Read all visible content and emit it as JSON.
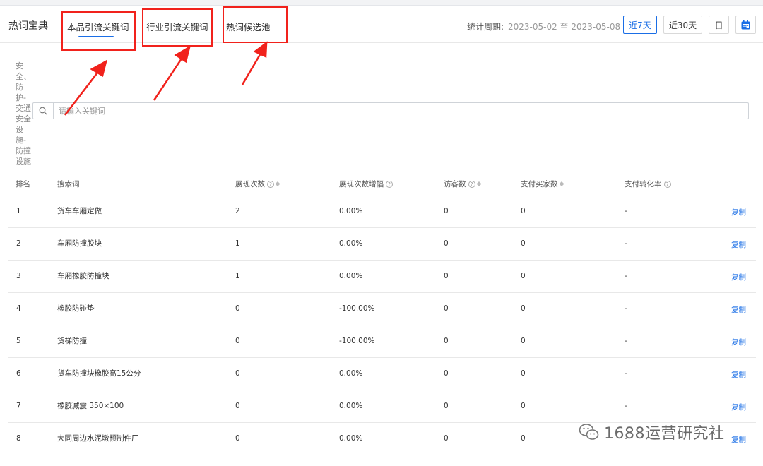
{
  "header": {
    "brand": "热词宝典",
    "tabs": [
      {
        "label": "本品引流关键词",
        "active": true
      },
      {
        "label": "行业引流关键词",
        "active": false
      },
      {
        "label": "热词候选池",
        "active": false
      }
    ],
    "period_label": "统计周期:",
    "period_value": "2023-05-02 至 2023-05-08",
    "buttons": [
      {
        "label": "近7天",
        "active": true
      },
      {
        "label": "近30天",
        "active": false
      },
      {
        "label": "日",
        "active": false
      }
    ],
    "calendar_icon": "calendar-icon"
  },
  "category": "安全、防护-交通安全设施-防撞设施",
  "search": {
    "placeholder": "请输入关键词",
    "value": ""
  },
  "table": {
    "columns": [
      "排名",
      "搜索词",
      "展现次数",
      "展现次数增幅",
      "访客数",
      "支付买家数",
      "支付转化率"
    ],
    "rows": [
      {
        "rank": "1",
        "keyword": "货车车厢定做",
        "impressions": "2",
        "growth": "0.00%",
        "visitors": "0",
        "buyers": "0",
        "conversion": "-",
        "action": "复制"
      },
      {
        "rank": "2",
        "keyword": "车厢防撞胶块",
        "impressions": "1",
        "growth": "0.00%",
        "visitors": "0",
        "buyers": "0",
        "conversion": "-",
        "action": "复制"
      },
      {
        "rank": "3",
        "keyword": "车厢橡胶防撞块",
        "impressions": "1",
        "growth": "0.00%",
        "visitors": "0",
        "buyers": "0",
        "conversion": "-",
        "action": "复制"
      },
      {
        "rank": "4",
        "keyword": "橡胶防碰垫",
        "impressions": "0",
        "growth": "-100.00%",
        "visitors": "0",
        "buyers": "0",
        "conversion": "-",
        "action": "复制"
      },
      {
        "rank": "5",
        "keyword": "货梯防撞",
        "impressions": "0",
        "growth": "-100.00%",
        "visitors": "0",
        "buyers": "0",
        "conversion": "-",
        "action": "复制"
      },
      {
        "rank": "6",
        "keyword": "货车防撞块橡胶高15公分",
        "impressions": "0",
        "growth": "0.00%",
        "visitors": "0",
        "buyers": "0",
        "conversion": "-",
        "action": "复制"
      },
      {
        "rank": "7",
        "keyword": "橡胶减震 350×100",
        "impressions": "0",
        "growth": "0.00%",
        "visitors": "0",
        "buyers": "0",
        "conversion": "-",
        "action": "复制"
      },
      {
        "rank": "8",
        "keyword": "大同周边水泥墩预制件厂",
        "impressions": "0",
        "growth": "0.00%",
        "visitors": "0",
        "buyers": "0",
        "conversion": "-",
        "action": "复制"
      }
    ]
  },
  "watermark": {
    "text": "1688运营研究社",
    "icon": "wechat-icon"
  },
  "annotation": {
    "color": "#f1221c"
  }
}
